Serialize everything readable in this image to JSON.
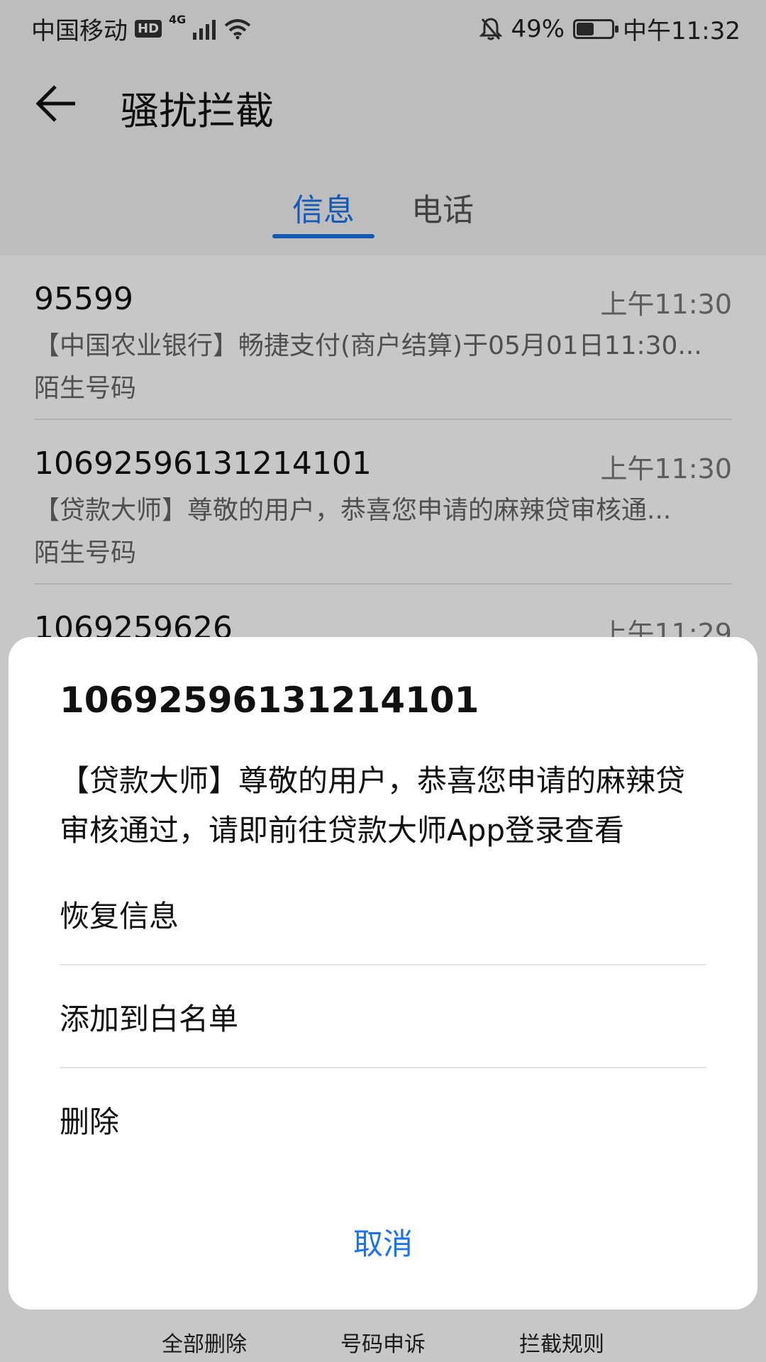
{
  "status_bar": {
    "carrier": "中国移动",
    "hd_badge": "HD",
    "network_gen": "4G",
    "battery_percent": "49%",
    "battery_level": 0.49,
    "time": "中午11:32"
  },
  "header": {
    "title": "骚扰拦截"
  },
  "tabs": [
    {
      "label": "信息",
      "active": true
    },
    {
      "label": "电话",
      "active": false
    }
  ],
  "list": {
    "items": [
      {
        "number": "95599",
        "time": "上午11:30",
        "preview": "【中国农业银行】畅捷支付(商户结算)于05月01日11:30...",
        "tag": "陌生号码"
      },
      {
        "number": "10692596131214101",
        "time": "上午11:30",
        "preview": "【贷款大师】尊敬的用户，恭喜您申请的麻辣贷审核通...",
        "tag": "陌生号码"
      },
      {
        "number": "1069259626",
        "time": "上午11:29",
        "preview": "",
        "tag": ""
      }
    ]
  },
  "bottom_bar": {
    "delete_all": "全部删除",
    "appeal": "号码申诉",
    "rules": "拦截规则"
  },
  "dialog": {
    "title": "10692596131214101",
    "message": "【贷款大师】尊敬的用户，恭喜您申请的麻辣贷审核通过，请即前往贷款大师App登录查看",
    "options": {
      "restore": "恢复信息",
      "whitelist": "添加到白名单",
      "delete": "删除"
    },
    "cancel": "取消"
  },
  "colors": {
    "accent": "#1a73e8",
    "scrim": "rgba(0,0,0,0.22)"
  }
}
